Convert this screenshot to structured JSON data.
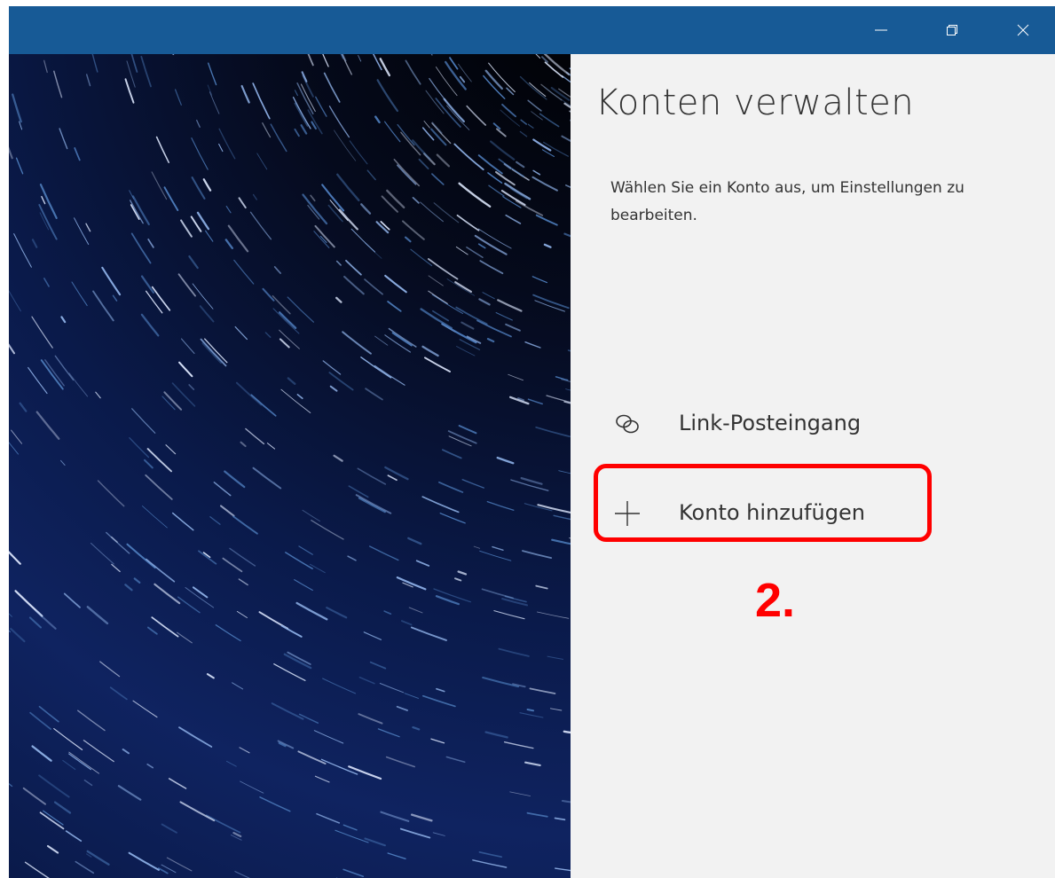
{
  "titlebar": {
    "color": "#175a96",
    "minimize_icon": "minimize-icon",
    "maximize_icon": "restore-icon",
    "close_icon": "close-icon"
  },
  "hero": {
    "description": "",
    "colors": [
      "#000000",
      "#0a1a4a",
      "#4f7fbf"
    ]
  },
  "pane": {
    "title": "Konten verwalten",
    "description": "Wählen Sie ein Konto aus, um Einstellungen zu bearbeiten.",
    "items": [
      {
        "label": "Link-Posteingang",
        "icon": "link-icon"
      },
      {
        "label": "Konto hinzufügen",
        "icon": "plus-icon"
      }
    ]
  },
  "annotation": {
    "step_label": "2.",
    "color": "#ff0000"
  }
}
